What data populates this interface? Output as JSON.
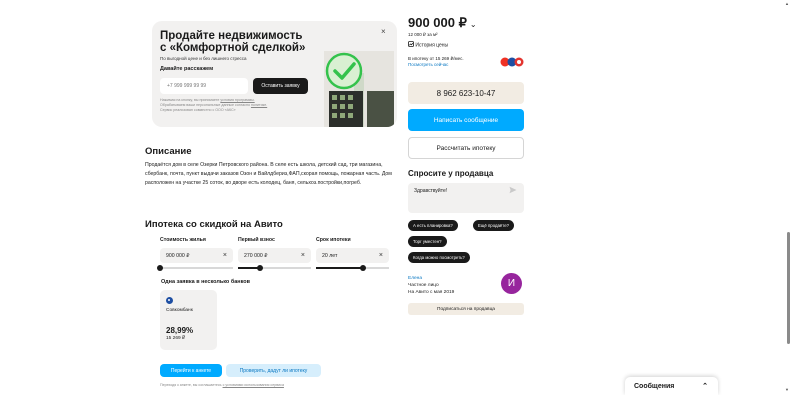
{
  "promo": {
    "title_line1": "Продайте недвижимость",
    "title_line2": "с «Комфортной сделкой»",
    "subtitle": "По выгодной цене и без лишнего стресса",
    "ask": "Давайте расскажем",
    "phone_placeholder": "+7 999 999 99 99",
    "submit_label": "Оставить заявку",
    "legal_1": "Нажимая на кнопку, вы принимаете",
    "legal_link_1": "условия программы.",
    "legal_2": "Обрабатываем ваши персональные данные согласно",
    "legal_link_2": "политике.",
    "legal_3": "Сервис реализован совместно с ООО «АКС»",
    "close": "×"
  },
  "description": {
    "heading": "Описание",
    "text": "Продаётся дом в селе Озерки Петровского района. В селе есть школа, детский сад, три магазина, сбербанк, почта, пункт выдачи заказов Озон и Вайлдбериз,ФАП,скорая помощь, пожарная часть. Дом расположен на участке 25 соток, во дворе есть колодец, баня, сельхоз.постройки,погреб."
  },
  "mortgage": {
    "heading": "Ипотека со скидкой на Авито",
    "fields": [
      {
        "label": "Стоимость жилья",
        "value": "900 000 ₽",
        "fill": 0.0
      },
      {
        "label": "Первый взнос",
        "value": "270 000 ₽",
        "fill": 0.3
      },
      {
        "label": "Срок ипотеки",
        "value": "20 лет",
        "fill": 0.65
      }
    ],
    "clear": "×",
    "banks_heading": "Одна заявка в несколько банков",
    "bank": {
      "name": "Совкомбанк",
      "rate": "28,99%",
      "payment": "15 269 ₽"
    },
    "apply_label": "Перейти к анкете",
    "check_label": "Проверить, дадут ли ипотеку",
    "footer_legal": "Переходя к анкете, вы соглашаетесь",
    "footer_link": "с условиями использования сервиса"
  },
  "sidebar": {
    "price": "900 000 ₽",
    "price_chevron": "⌄",
    "per_meter": "12 000 ₽ за м²",
    "price_history": "История цены",
    "mortgage_from": "В ипотеку от 15 269 ₽/мес.",
    "mortgage_link": "Посмотреть сейчас",
    "phone": "8 962 623-10-47",
    "write_label": "Написать сообщение",
    "calc_label": "Рассчитать ипотеку",
    "ask_heading": "Спросите у продавца",
    "message_value": "Здравствуйте!",
    "chips": [
      "А есть планировка?",
      "Ещё продаёте?",
      "Торг уместен?",
      "Когда можно посмотреть?"
    ],
    "seller_name": "Елена",
    "seller_type": "Частное лицо",
    "seller_since": "На Авито с мая 2019",
    "avatar_letter": "И",
    "subscribe_label": "Подписаться на продавца"
  },
  "messenger": {
    "label": "Сообщения",
    "chevron": "⌃"
  },
  "colors": {
    "accent": "#00aaff",
    "link": "#0a78c2",
    "avatar": "#97259d",
    "check_green": "#34c24c"
  }
}
